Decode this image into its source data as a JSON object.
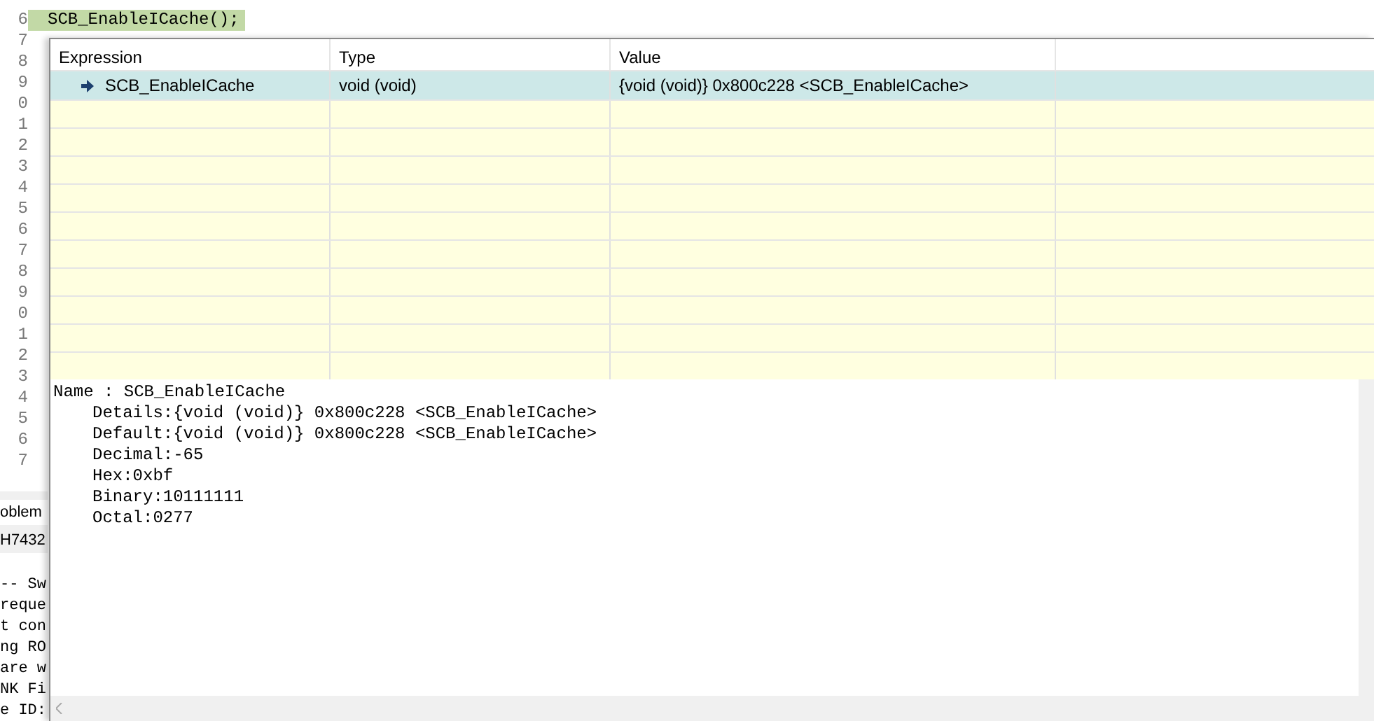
{
  "editor": {
    "line_numbers": [
      "6",
      "7",
      "8",
      "9",
      "0",
      "1",
      "2",
      "3",
      "4",
      "5",
      "6",
      "7",
      "8",
      "9",
      "0",
      "1",
      "2",
      "3",
      "4",
      "5",
      "6",
      "7"
    ],
    "current_line": {
      "code": "SCB_EnableICache();",
      "highlighted": true
    }
  },
  "bottom_panel": {
    "tab": "oblem",
    "console_title": "H7432",
    "console_lines": [
      "-- Sw",
      "reque",
      "t con",
      "ng RO",
      "are w",
      "NK Fi",
      "e ID:"
    ]
  },
  "hover": {
    "columns": [
      "Expression",
      "Type",
      "Value"
    ],
    "rows": [
      {
        "expression": "SCB_EnableICache",
        "type": "void (void)",
        "value": "{void (void)} 0x800c228 <SCB_EnableICache>",
        "selected": true
      }
    ],
    "details": [
      {
        "text": "Name : SCB_EnableICache",
        "indented": false
      },
      {
        "text": "Details:{void (void)} 0x800c228 <SCB_EnableICache>",
        "indented": true
      },
      {
        "text": "Default:{void (void)} 0x800c228 <SCB_EnableICache>",
        "indented": true
      },
      {
        "text": "Decimal:-65",
        "indented": true
      },
      {
        "text": "Hex:0xbf",
        "indented": true
      },
      {
        "text": "Binary:10111111",
        "indented": true
      },
      {
        "text": "Octal:0277",
        "indented": true
      }
    ]
  }
}
